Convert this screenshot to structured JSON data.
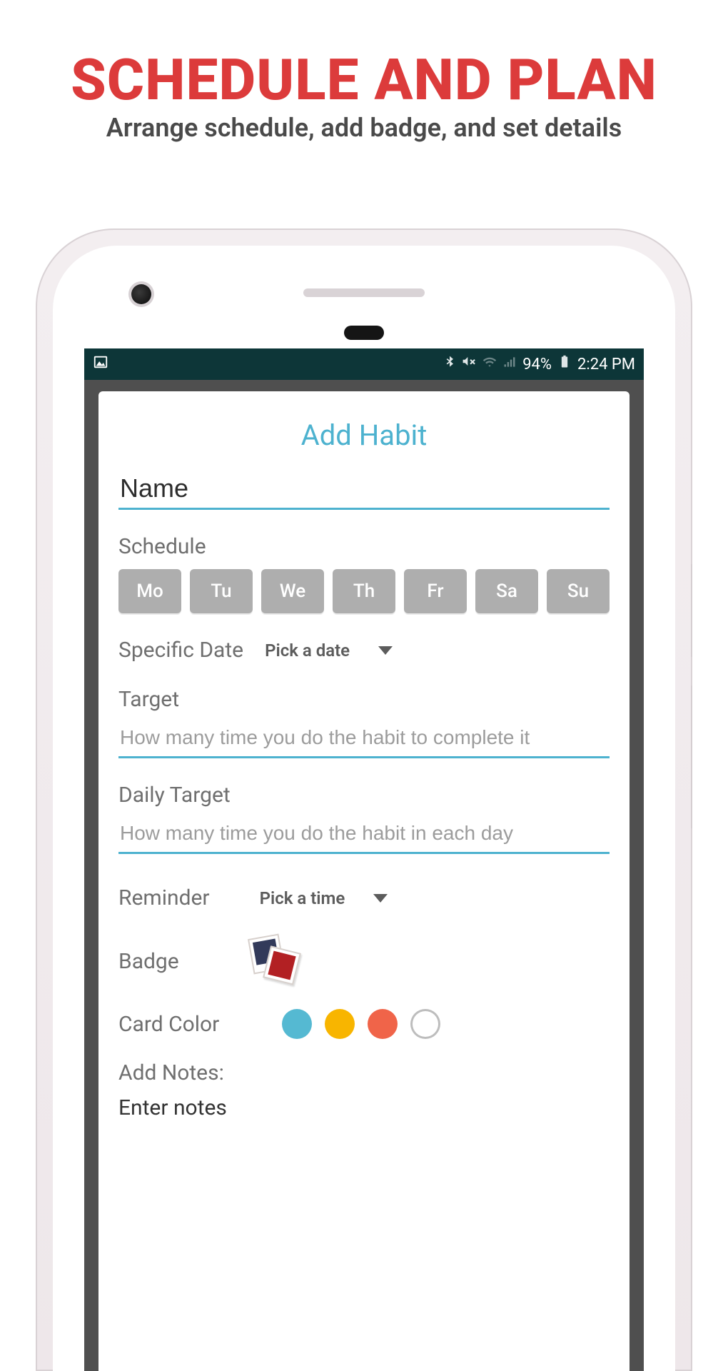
{
  "promo": {
    "title": "SCHEDULE AND PLAN",
    "subtitle": "Arrange schedule, add badge, and set details"
  },
  "statusbar": {
    "battery_pct": "94%",
    "time": "2:24 PM"
  },
  "app": {
    "title": "Add Habit",
    "name_placeholder": "Name",
    "schedule_label": "Schedule",
    "days": [
      "Mo",
      "Tu",
      "We",
      "Th",
      "Fr",
      "Sa",
      "Su"
    ],
    "specific_date_label": "Specific Date",
    "specific_date_picker": "Pick a date",
    "target_label": "Target",
    "target_placeholder": "How many time you do the habit to complete it",
    "daily_target_label": "Daily Target",
    "daily_target_placeholder": "How many time you do the habit in each day",
    "reminder_label": "Reminder",
    "reminder_picker": "Pick a time",
    "badge_label": "Badge",
    "card_color_label": "Card Color",
    "card_colors": [
      "#55b9d2",
      "#f8b500",
      "#f06449",
      "outline"
    ],
    "notes_label": "Add Notes:",
    "notes_value": "Enter notes"
  }
}
